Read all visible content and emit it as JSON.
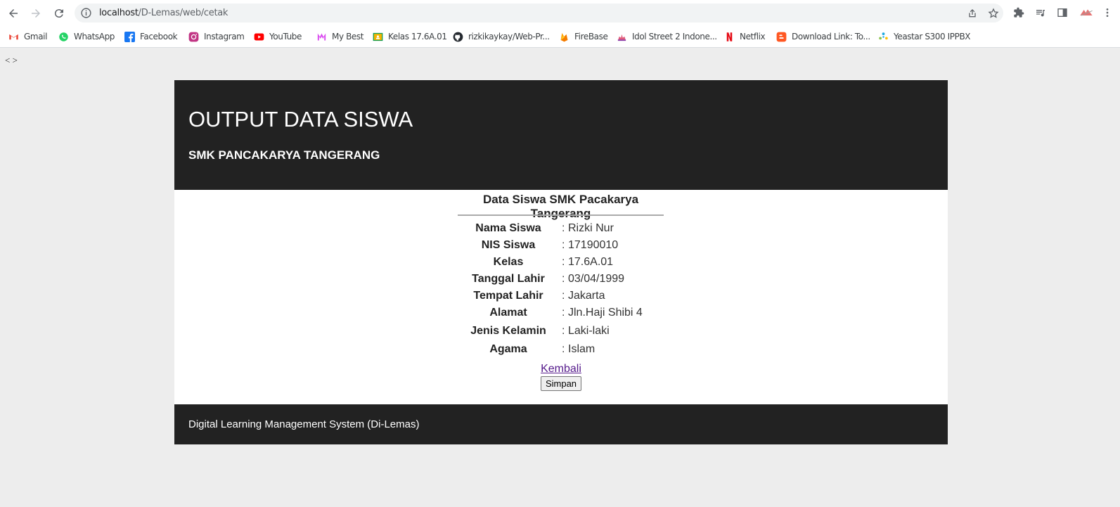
{
  "browser": {
    "url_host": "localhost",
    "url_path": "/D-Lemas/web/cetak",
    "bookmarks": [
      {
        "label": "Gmail",
        "icon": "gmail-icon",
        "color": "#ea4335"
      },
      {
        "label": "WhatsApp",
        "icon": "whatsapp-icon",
        "color": "#25d366"
      },
      {
        "label": "Facebook",
        "icon": "facebook-icon",
        "color": "#1877f2"
      },
      {
        "label": "Instagram",
        "icon": "instagram-icon",
        "color": "#c13584"
      },
      {
        "label": "YouTube",
        "icon": "youtube-icon",
        "color": "#ff0000"
      },
      {
        "label": "My Best",
        "icon": "mybest-icon",
        "color": "#d946ef"
      },
      {
        "label": "Kelas 17.6A.01",
        "icon": "classroom-icon",
        "color": "#f4b400"
      },
      {
        "label": "rizkikaykay/Web-Pr...",
        "icon": "github-icon",
        "color": "#24292f"
      },
      {
        "label": "FireBase",
        "icon": "firebase-icon",
        "color": "#ffca28"
      },
      {
        "label": "Idol Street 2 Indone...",
        "icon": "idol-street-icon",
        "color": "#e05a7a"
      },
      {
        "label": "Netflix",
        "icon": "netflix-icon",
        "color": "#e50914"
      },
      {
        "label": "Download Link: To...",
        "icon": "blogger-icon",
        "color": "#ff5722"
      },
      {
        "label": "Yeastar S300 IPPBX",
        "icon": "yeastar-icon",
        "color": "#1aa9e0"
      }
    ]
  },
  "page": {
    "pager_text": "< >",
    "header_title": "OUTPUT DATA SISWA",
    "header_subtitle": "SMK PANCAKARYA TANGERANG",
    "section_title": "Data Siswa SMK Pacakarya Tangerang",
    "separator": ":",
    "fields": [
      {
        "label": "Nama Siswa",
        "value": "Rizki Nur"
      },
      {
        "label": "NIS Siswa",
        "value": "17190010"
      },
      {
        "label": "Kelas",
        "value": "17.6A.01"
      },
      {
        "label": "Tanggal Lahir",
        "value": "03/04/1999"
      },
      {
        "label": "Tempat Lahir",
        "value": "Jakarta"
      },
      {
        "label": "Alamat",
        "value": "Jln.Haji Shibi 4"
      },
      {
        "label": "Jenis Kelamin",
        "value": "Laki-laki"
      },
      {
        "label": "Agama",
        "value": "Islam"
      }
    ],
    "back_link": "Kembali",
    "save_button": "Simpan",
    "footer_text": "Digital Learning Management System (Di-Lemas)"
  }
}
